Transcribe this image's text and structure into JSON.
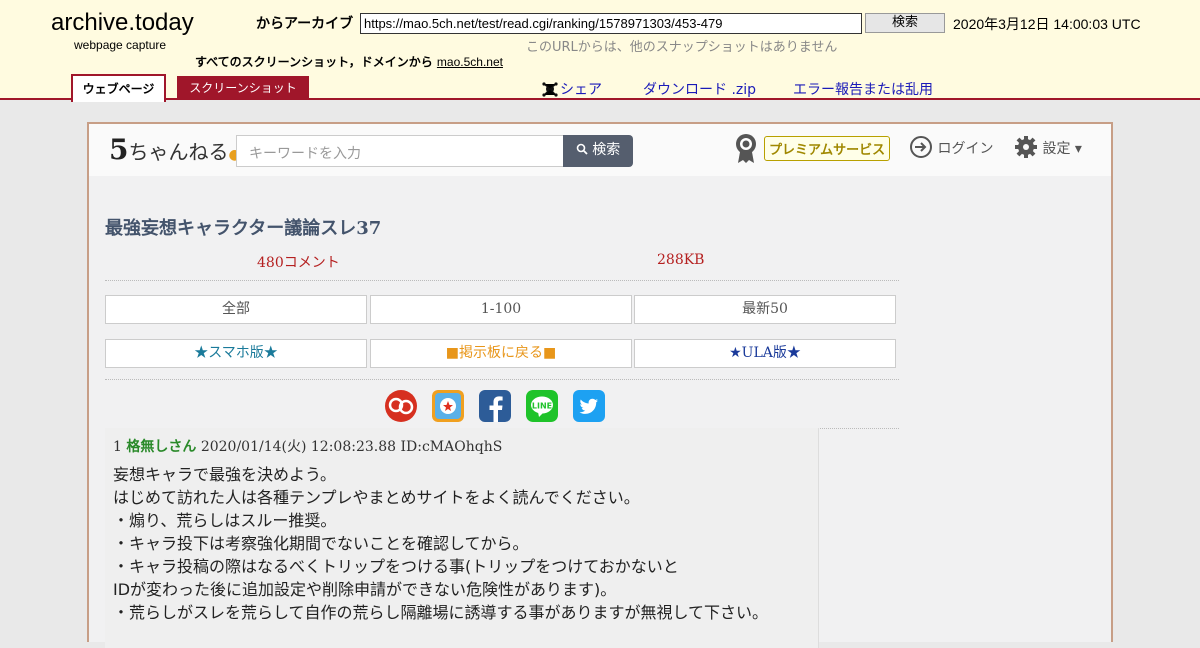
{
  "archive": {
    "logo": "archive.today",
    "logo_sub": "webpage capture",
    "from_label": "からアーカイブ",
    "url": "https://mao.5ch.net/test/read.cgi/ranking/1578971303/453-479",
    "search_label": "検索",
    "capture_date": "2020年3月12日 14:00:03 UTC",
    "no_snapshots": "このURLからは、他のスナップショットはありません",
    "all_screenshots": "すべてのスクリーンショット，ドメインから",
    "domain": "mao.5ch.net",
    "tabs": {
      "webpage": "ウェブページ",
      "screenshot": "スクリーンショット"
    },
    "actions": {
      "share": "シェア",
      "download": "ダウンロード .zip",
      "report": "エラー報告または乱用"
    },
    "accent": "#a0162a"
  },
  "site": {
    "logo_digit": "5",
    "logo_text": "ちゃんねる",
    "search_placeholder": "キーワードを入力",
    "search_button": "検索",
    "premium": "プレミアムサービス",
    "login": "ログイン",
    "settings": "設定"
  },
  "thread": {
    "title": "最強妄想キャラクター議論スレ37",
    "comments": "480コメント",
    "size": "288KB",
    "nav": [
      "全部",
      "1-100",
      "最新50"
    ],
    "links": [
      "★スマホ版★",
      "■掲示板に戻る■",
      "★ULA版★"
    ]
  },
  "post": {
    "number": "1",
    "name": "格無しさん",
    "datetime": "2020/01/14(火) 12:08:23.88 ID:cMAOhqhS",
    "lines": [
      "妄想キャラで最強を決めよう。",
      "はじめて訪れた人は各種テンプレやまとめサイトをよく読んでください。",
      "・煽り、荒らしはスルー推奨。",
      "・キャラ投下は考察強化期間でないことを確認してから。",
      "・キャラ投稿の際はなるべくトリップをつける事(トリップをつけておかないと",
      "IDが変わった後に追加設定や削除申請ができない危険性があります)。",
      "・荒らしがスレを荒らして自作の荒らし隔離場に誘導する事がありますが無視して下さい。"
    ]
  },
  "social_icons": [
    "sukitoku-icon",
    "bookmark-icon",
    "facebook-icon",
    "line-icon",
    "twitter-icon"
  ]
}
